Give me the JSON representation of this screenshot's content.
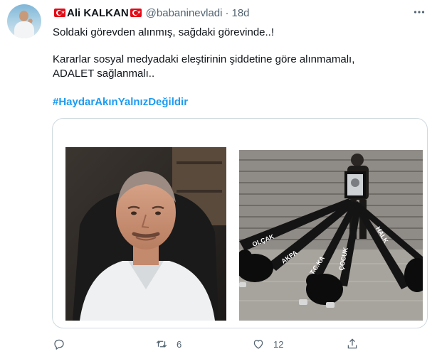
{
  "tweet": {
    "author": {
      "name": "Ali KALKAN",
      "handle": "@babaninevladi",
      "separator": "·",
      "time": "18d"
    },
    "lines": {
      "line1": "Soldaki görevden alınmış, sağdaki görevinde..!",
      "line2": "Kararlar sosyal medyadaki eleştirinin şiddetine göre alınmamalı,",
      "line3": "ADALET sağlanmalı.."
    },
    "hashtag": "#HaydarAkınYalnızDeğildir",
    "media": {
      "left_photo": "portrait",
      "right_photo": "ceremony",
      "banner_words": [
        "OLÇAK",
        "AKPA",
        "T.C.KA",
        "ÇOCUK",
        "HALK"
      ]
    },
    "actions": {
      "reply_count": "",
      "retweet_count": "6",
      "like_count": "12"
    },
    "icons": {
      "reply": "reply-icon",
      "retweet": "retweet-icon",
      "like": "heart-icon",
      "share": "share-icon",
      "more": "more-icon",
      "flag": "turkey-flag-icon"
    },
    "colors": {
      "link": "#1d9bf0",
      "muted": "#536471",
      "border": "#cfd9de",
      "flag": "#e30a17"
    }
  }
}
